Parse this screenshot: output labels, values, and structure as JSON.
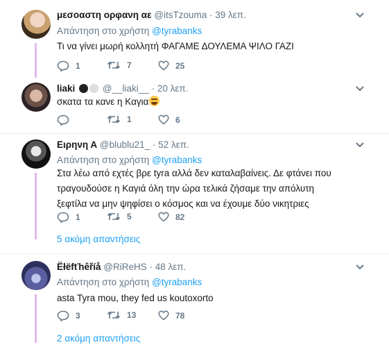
{
  "tweets": [
    {
      "name": "μεσοαστη ορφανη αε",
      "handle": "@itsTzouma",
      "time": "39 λεπ.",
      "reply_label": "Απάντηση στο χρήστη",
      "reply_mention": "@tyrabanks",
      "text": "Τι να γίνει μωρή κολλητή ΦΑΓΑΜΕ ΔΟΥΛΕΜΑ ΨΙΛΟ ΓΑΖΙ",
      "replies": "1",
      "retweets": "7",
      "likes": "25"
    },
    {
      "name": "liaki",
      "handle": "@__liaki__",
      "time": "20 λεπ.",
      "text": "σκατα τα κανε η Καγια",
      "replies": "",
      "retweets": "1",
      "likes": "6"
    },
    {
      "name": "Ειρηνη Α",
      "handle": "@blublu21_",
      "time": "52 λεπ.",
      "reply_label": "Απάντηση στο χρήστη",
      "reply_mention": "@tyrabanks",
      "text": "Στα λέω από εχτές βρε tyra αλλά δεν καταλαβαίνεις. Δε φτάνει που τραγουδούσε η Καγιά όλη την ώρα τελικά ζήσαμε την απόλυτη ξεφτίλα να μην ψηφίσει ο κόσμος και να έχουμε δύο νικητριες",
      "replies": "1",
      "retweets": "5",
      "likes": "82",
      "more": "5 ακόμη απαντήσεις"
    },
    {
      "name": "Ëłëfťhêříå",
      "handle": "@RiReHS",
      "time": "48 λεπ.",
      "reply_label": "Απάντηση στο χρήστη",
      "reply_mention": "@tyrabanks",
      "text": "asta Tyra mou, they fed us koutoxorto",
      "replies": "3",
      "retweets": "13",
      "likes": "78",
      "more": "2 ακόμη απαντήσεις"
    }
  ],
  "dot_separator": "·",
  "colors": {
    "thread_line": "#e1b8ea",
    "link": "#1da1f2",
    "muted": "#657786"
  }
}
